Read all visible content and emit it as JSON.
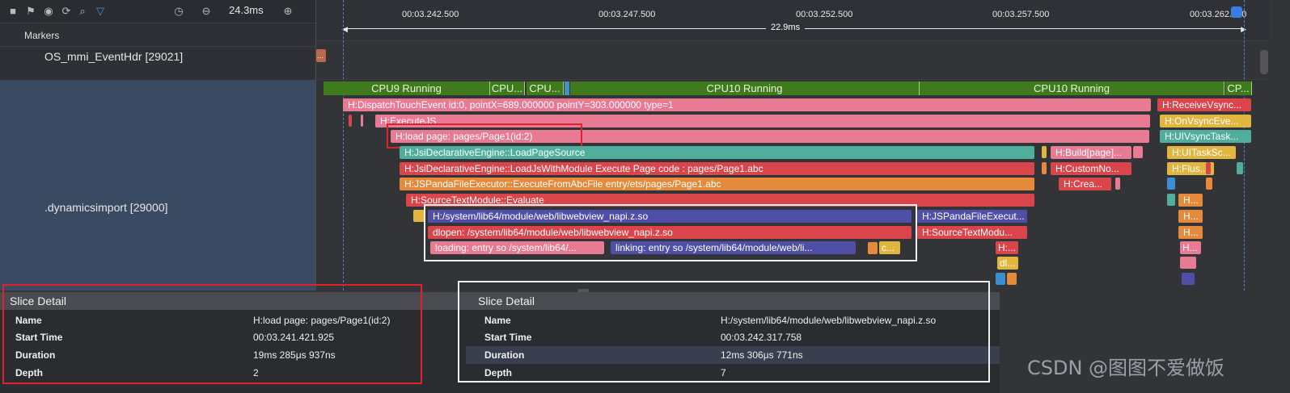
{
  "toolbar": {
    "zoom_value": "24.3ms",
    "icons": [
      "square-icon",
      "flag-icon",
      "compass-icon",
      "refresh-icon",
      "search-icon",
      "filter-icon",
      "timer-icon",
      "zoom-out-icon",
      "zoom-in-icon"
    ]
  },
  "rows": {
    "markers": "Markers",
    "os_thread": "OS_mmi_EventHdr [29021]",
    "main_thread": ".dynamicsimport [29000]"
  },
  "ruler": {
    "ticks": [
      "00:03.242.500",
      "00:03.247.500",
      "00:03.252.500",
      "00:03.257.500",
      "00:03.262.500"
    ],
    "range_label": "22.9ms"
  },
  "os_slice": "...",
  "cpu": [
    "CPU9 Running",
    "CPU...",
    "CPU...",
    "CPU10 Running",
    "CPU10 Running",
    "CP..."
  ],
  "slices": {
    "dispatch": "H:DispatchTouchEvent id:0, pointX=689.000000 pointY=303.000000 type=1",
    "receive_vsync": "H:ReceiveVsync...",
    "execute_js": "H:ExecuteJS",
    "on_vsync": "H:OnVsyncEve...",
    "load_page": "H:load page: pages/Page1(id:2)",
    "ui_vsync_task": "H:UIVsyncTask...",
    "load_page_source": "H:JsiDeclarativeEngine::LoadPageSource",
    "build_page": "H:Build[page]...",
    "ui_task_sc": "H:UITaskSc...",
    "load_js_with_module": "H:JsiDeclarativeEngine::LoadJsWithModule Execute Page code : pages/Page1.abc",
    "custom_no": "H:CustomNo...",
    "flus": "H:Flus...",
    "execute_from_abc": "H:JSPandaFileExecutor::ExecuteFromAbcFile entry/ets/pages/Page1.abc",
    "crea": "H:Crea...",
    "evaluate": "H:SourceTextModule::Evaluate",
    "h_small_1": "H...",
    "webview_so": "H:/system/lib64/module/web/libwebview_napi.z.so",
    "panda_execut": "H:JSPandaFileExecut...",
    "dlopen": "dlopen:  /system/lib64/module/web/libwebview_napi.z.so",
    "source_text_modu": "H:SourceTextModu...",
    "loading": "loading: entry so /system/lib64/...",
    "linking": "linking: entry so /system/lib64/module/web/li...",
    "c_small": "c...",
    "h_small_2": "H:...",
    "dl_small": "dl...",
    "h_small_3": "H...",
    "h_small_4": "H...",
    "h_small_5": "H..."
  },
  "detail_left": {
    "title": "Slice Detail",
    "rows": [
      {
        "key": "Name",
        "value": "H:load page: pages/Page1(id:2)"
      },
      {
        "key": "Start Time",
        "value": "00:03.241.421.925"
      },
      {
        "key": "Duration",
        "value": "19ms 285μs 937ns"
      },
      {
        "key": "Depth",
        "value": "2"
      }
    ]
  },
  "detail_right": {
    "title": "Slice Detail",
    "rows": [
      {
        "key": "Name",
        "value": "H:/system/lib64/module/web/libwebview_napi.z.so"
      },
      {
        "key": "Start Time",
        "value": "00:03.242.317.758"
      },
      {
        "key": "Duration",
        "value": "12ms 306μs 771ns"
      },
      {
        "key": "Depth",
        "value": "7"
      }
    ]
  },
  "watermark": "CSDN @图图不爱做饭",
  "colors": {
    "pink": "#e87a93",
    "teal": "#4fae9c",
    "red": "#d9454a",
    "orange": "#e58a3a",
    "indigo": "#4f4fa8",
    "cpu_green": "#3f7a1c",
    "highlight_red": "#e0202a"
  }
}
